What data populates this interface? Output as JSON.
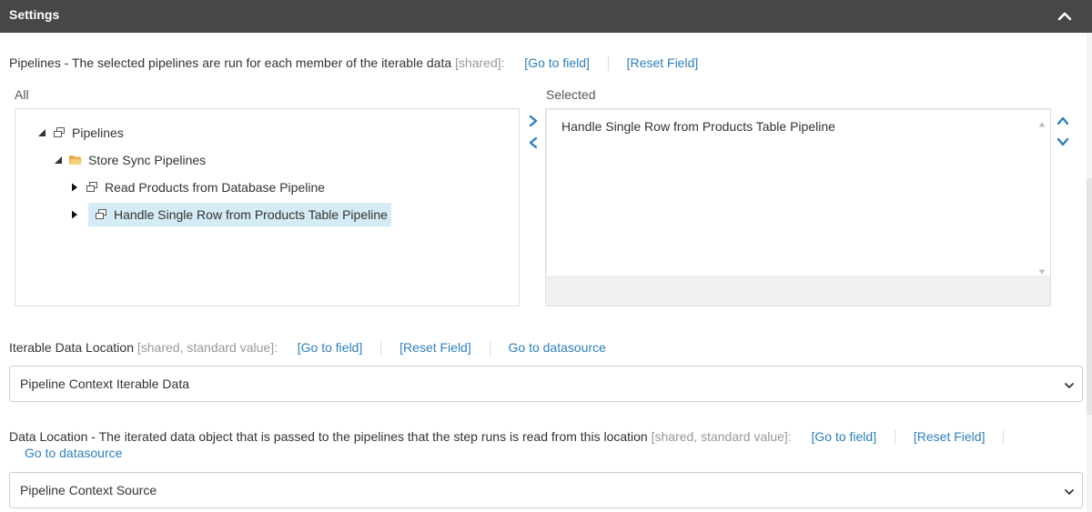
{
  "header": {
    "title": "Settings"
  },
  "pipelines_field": {
    "label": "Pipelines - The selected pipelines are run for each member of the iterable data",
    "tag": "[shared]:",
    "links": [
      "[Go to field]",
      "[Reset Field]"
    ],
    "all_label": "All",
    "selected_label": "Selected",
    "tree": [
      {
        "label": "Pipelines"
      },
      {
        "label": "Store Sync Pipelines"
      },
      {
        "label": "Read Products from Database Pipeline"
      },
      {
        "label": "Handle Single Row from Products Table Pipeline"
      }
    ],
    "selected_items": [
      "Handle Single Row from Products Table Pipeline"
    ]
  },
  "iterable_field": {
    "label": "Iterable Data Location",
    "tag": "[shared, standard value]:",
    "links": [
      "[Go to field]",
      "[Reset Field]",
      "Go to datasource"
    ],
    "value": "Pipeline Context Iterable Data"
  },
  "data_location_field": {
    "label": "Data Location - The iterated data object that is passed to the pipelines that the step runs is read from this location",
    "tag": "[shared, standard value]:",
    "links": [
      "[Go to field]",
      "[Reset Field]",
      "Go to datasource"
    ],
    "value": "Pipeline Context Source"
  },
  "colors": {
    "header_bg": "#474747",
    "link": "#2f7fb8",
    "selection": "#d5ebf6",
    "folder": "#f0c46c"
  }
}
